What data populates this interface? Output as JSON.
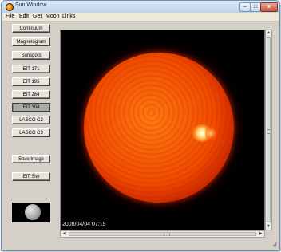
{
  "window": {
    "title": "Sun Window",
    "controls": {
      "minimize": "–",
      "maximize": "□",
      "close": "x"
    }
  },
  "menubar": {
    "items": [
      "File",
      "Edit",
      "Get",
      "Moon",
      "Links"
    ]
  },
  "sidebar": {
    "buttons": [
      {
        "label": "Continuum",
        "active": false
      },
      {
        "label": "Magnetogram",
        "active": false
      },
      {
        "label": "Sunspots",
        "active": false
      },
      {
        "label": "EIT 171",
        "active": false
      },
      {
        "label": "EIT 195",
        "active": false
      },
      {
        "label": "EIT 284",
        "active": false
      },
      {
        "label": "EIT 304",
        "active": true
      },
      {
        "label": "LASCO C2",
        "active": false
      },
      {
        "label": "LASCO C3",
        "active": false
      }
    ],
    "save_image": "Save Image",
    "eit_site": "EIT Site"
  },
  "viewer": {
    "timestamp": "2008/04/04 07:19"
  },
  "icons": {
    "app": "sun-icon",
    "moon": "moon-phase-thumbnail"
  },
  "colors": {
    "sun_core": "#f04a00",
    "sun_limb": "#6a0800",
    "active_button": "#a9a9a9"
  }
}
